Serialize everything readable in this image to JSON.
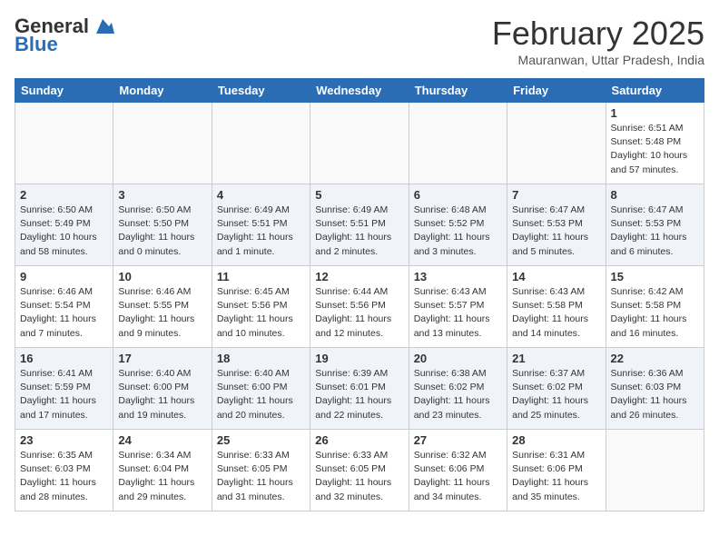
{
  "header": {
    "logo_general": "General",
    "logo_blue": "Blue",
    "title": "February 2025",
    "location": "Mauranwan, Uttar Pradesh, India"
  },
  "days_of_week": [
    "Sunday",
    "Monday",
    "Tuesday",
    "Wednesday",
    "Thursday",
    "Friday",
    "Saturday"
  ],
  "weeks": [
    [
      {
        "day": "",
        "info": ""
      },
      {
        "day": "",
        "info": ""
      },
      {
        "day": "",
        "info": ""
      },
      {
        "day": "",
        "info": ""
      },
      {
        "day": "",
        "info": ""
      },
      {
        "day": "",
        "info": ""
      },
      {
        "day": "1",
        "info": "Sunrise: 6:51 AM\nSunset: 5:48 PM\nDaylight: 10 hours and 57 minutes."
      }
    ],
    [
      {
        "day": "2",
        "info": "Sunrise: 6:50 AM\nSunset: 5:49 PM\nDaylight: 10 hours and 58 minutes."
      },
      {
        "day": "3",
        "info": "Sunrise: 6:50 AM\nSunset: 5:50 PM\nDaylight: 11 hours and 0 minutes."
      },
      {
        "day": "4",
        "info": "Sunrise: 6:49 AM\nSunset: 5:51 PM\nDaylight: 11 hours and 1 minute."
      },
      {
        "day": "5",
        "info": "Sunrise: 6:49 AM\nSunset: 5:51 PM\nDaylight: 11 hours and 2 minutes."
      },
      {
        "day": "6",
        "info": "Sunrise: 6:48 AM\nSunset: 5:52 PM\nDaylight: 11 hours and 3 minutes."
      },
      {
        "day": "7",
        "info": "Sunrise: 6:47 AM\nSunset: 5:53 PM\nDaylight: 11 hours and 5 minutes."
      },
      {
        "day": "8",
        "info": "Sunrise: 6:47 AM\nSunset: 5:53 PM\nDaylight: 11 hours and 6 minutes."
      }
    ],
    [
      {
        "day": "9",
        "info": "Sunrise: 6:46 AM\nSunset: 5:54 PM\nDaylight: 11 hours and 7 minutes."
      },
      {
        "day": "10",
        "info": "Sunrise: 6:46 AM\nSunset: 5:55 PM\nDaylight: 11 hours and 9 minutes."
      },
      {
        "day": "11",
        "info": "Sunrise: 6:45 AM\nSunset: 5:56 PM\nDaylight: 11 hours and 10 minutes."
      },
      {
        "day": "12",
        "info": "Sunrise: 6:44 AM\nSunset: 5:56 PM\nDaylight: 11 hours and 12 minutes."
      },
      {
        "day": "13",
        "info": "Sunrise: 6:43 AM\nSunset: 5:57 PM\nDaylight: 11 hours and 13 minutes."
      },
      {
        "day": "14",
        "info": "Sunrise: 6:43 AM\nSunset: 5:58 PM\nDaylight: 11 hours and 14 minutes."
      },
      {
        "day": "15",
        "info": "Sunrise: 6:42 AM\nSunset: 5:58 PM\nDaylight: 11 hours and 16 minutes."
      }
    ],
    [
      {
        "day": "16",
        "info": "Sunrise: 6:41 AM\nSunset: 5:59 PM\nDaylight: 11 hours and 17 minutes."
      },
      {
        "day": "17",
        "info": "Sunrise: 6:40 AM\nSunset: 6:00 PM\nDaylight: 11 hours and 19 minutes."
      },
      {
        "day": "18",
        "info": "Sunrise: 6:40 AM\nSunset: 6:00 PM\nDaylight: 11 hours and 20 minutes."
      },
      {
        "day": "19",
        "info": "Sunrise: 6:39 AM\nSunset: 6:01 PM\nDaylight: 11 hours and 22 minutes."
      },
      {
        "day": "20",
        "info": "Sunrise: 6:38 AM\nSunset: 6:02 PM\nDaylight: 11 hours and 23 minutes."
      },
      {
        "day": "21",
        "info": "Sunrise: 6:37 AM\nSunset: 6:02 PM\nDaylight: 11 hours and 25 minutes."
      },
      {
        "day": "22",
        "info": "Sunrise: 6:36 AM\nSunset: 6:03 PM\nDaylight: 11 hours and 26 minutes."
      }
    ],
    [
      {
        "day": "23",
        "info": "Sunrise: 6:35 AM\nSunset: 6:03 PM\nDaylight: 11 hours and 28 minutes."
      },
      {
        "day": "24",
        "info": "Sunrise: 6:34 AM\nSunset: 6:04 PM\nDaylight: 11 hours and 29 minutes."
      },
      {
        "day": "25",
        "info": "Sunrise: 6:33 AM\nSunset: 6:05 PM\nDaylight: 11 hours and 31 minutes."
      },
      {
        "day": "26",
        "info": "Sunrise: 6:33 AM\nSunset: 6:05 PM\nDaylight: 11 hours and 32 minutes."
      },
      {
        "day": "27",
        "info": "Sunrise: 6:32 AM\nSunset: 6:06 PM\nDaylight: 11 hours and 34 minutes."
      },
      {
        "day": "28",
        "info": "Sunrise: 6:31 AM\nSunset: 6:06 PM\nDaylight: 11 hours and 35 minutes."
      },
      {
        "day": "",
        "info": ""
      }
    ]
  ]
}
